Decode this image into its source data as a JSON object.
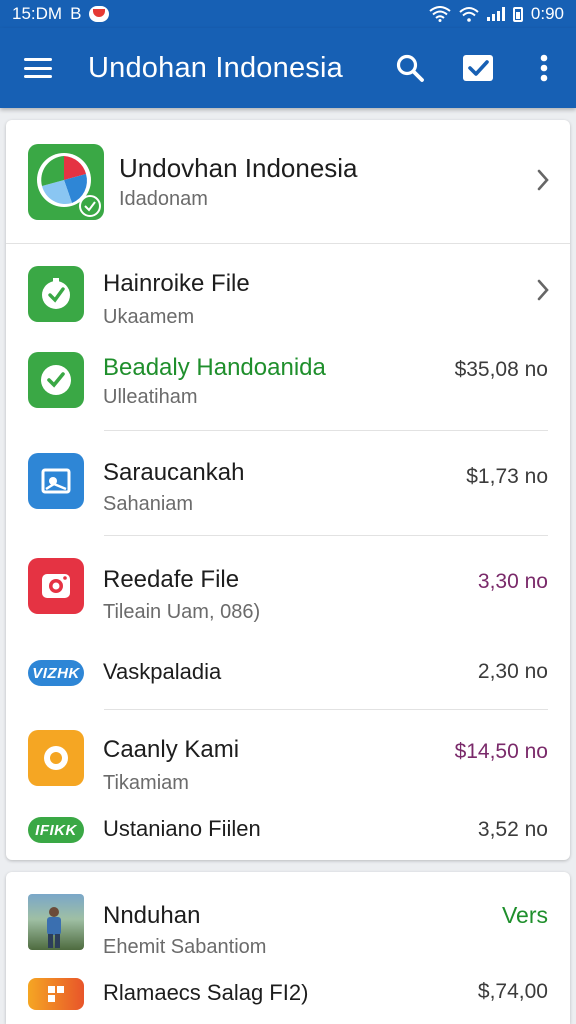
{
  "status_bar": {
    "time": "15:DM",
    "carrier": "B",
    "clock_right": "0:90"
  },
  "app_bar": {
    "title": "Undohan Indonesia",
    "search_icon": "search-icon",
    "check_icon": "checkbox-icon",
    "more_icon": "more-vert-icon"
  },
  "header_item": {
    "title": "Undovhan Indonesia",
    "subtitle": "Idadonam"
  },
  "items": [
    {
      "title": "Hainroike File",
      "subtitle": "Ukaamem",
      "price": "",
      "chevron": true
    },
    {
      "title": "Beadaly Handoanida",
      "subtitle": "Ulleatiham",
      "price": "$35,08 no",
      "title_color": "#1f8f2c"
    },
    {
      "title": "Saraucankah",
      "subtitle": "Sahaniam",
      "price": "$1,73 no"
    },
    {
      "title": "Reedafe File",
      "subtitle": "Tileain Uam, 086)",
      "price": "3,30 no",
      "price_color": "#7a2a6a"
    },
    {
      "pill": "VIZHK",
      "title": "Vaskpaladia",
      "price": "2,30 no"
    },
    {
      "title": "Caanly Kami",
      "subtitle": "Tikamiam",
      "price": "$14,50 no",
      "price_color": "#7a2a6a"
    },
    {
      "pill": "IFIKK",
      "title": "Ustaniano Fiilen",
      "price": "3,52 no"
    }
  ],
  "bottom_card": {
    "title": "Nnduhan",
    "subtitle": "Ehemit Sabantiom",
    "tag": "Vers",
    "tag_color": "#1f8f2c",
    "row2_title": "Rlamaecs Salag FI2)",
    "row2_price": "$,74,00"
  },
  "colors": {
    "primary": "#1760b4",
    "green": "#3aa845",
    "blue": "#2e86d6",
    "red": "#e53343",
    "orange": "#f5a623"
  }
}
